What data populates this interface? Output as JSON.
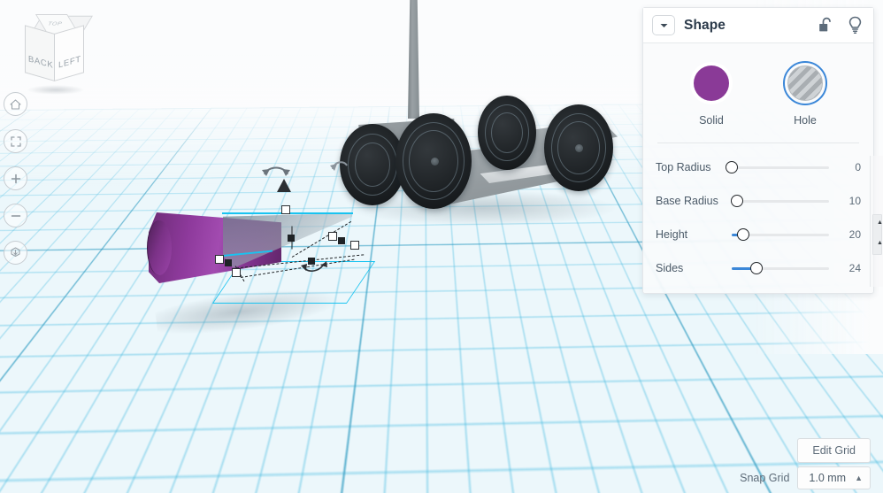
{
  "app": {
    "name": "tinkercad-3d-editor"
  },
  "viewcube": {
    "faces": {
      "back": "BACK",
      "left": "LEFT",
      "top": "TOP"
    }
  },
  "toolbar": {
    "items": [
      {
        "name": "home-view-button",
        "icon": "home-icon"
      },
      {
        "name": "fit-to-view-button",
        "icon": "fit-frame-icon"
      },
      {
        "name": "zoom-in-button",
        "icon": "plus-icon"
      },
      {
        "name": "zoom-out-button",
        "icon": "minus-icon"
      },
      {
        "name": "perspective-toggle-button",
        "icon": "cube-arrow-icon"
      }
    ]
  },
  "panel": {
    "title": "Shape",
    "collapse_icon": "chevron-down-icon",
    "lock_icon": "unlocked-padlock-icon",
    "light_icon": "lightbulb-icon",
    "modes": [
      {
        "label": "Solid",
        "color": "#8a3a97",
        "selected": false
      },
      {
        "label": "Hole",
        "color": "#b8bdc1",
        "selected": true
      }
    ],
    "selected_accent": "#3b87d8",
    "parameters": [
      {
        "label": "Top Radius",
        "value": "0",
        "percent": 0,
        "fill_percent": 0
      },
      {
        "label": "Base Radius",
        "value": "10",
        "percent": 5,
        "fill_percent": 0
      },
      {
        "label": "Height",
        "value": "20",
        "percent": 12,
        "fill_percent": 12
      },
      {
        "label": "Sides",
        "value": "24",
        "percent": 25,
        "fill_percent": 25
      }
    ]
  },
  "footer": {
    "edit_grid_label": "Edit Grid",
    "snap_grid_label": "Snap Grid",
    "snap_grid_value": "1.0 mm",
    "snap_caret_icon": "caret-up-icon"
  },
  "scene": {
    "objects": [
      {
        "name": "cone-solid-purple",
        "type": "cone",
        "mode": "solid"
      },
      {
        "name": "cone-hole-selected",
        "type": "cone",
        "mode": "hole",
        "selected": true
      },
      {
        "name": "vehicle-chassis",
        "type": "group"
      },
      {
        "name": "mast-pole",
        "type": "box"
      }
    ],
    "selection_color": "#19c3f0",
    "workplane_color": "#ecf7fb"
  }
}
